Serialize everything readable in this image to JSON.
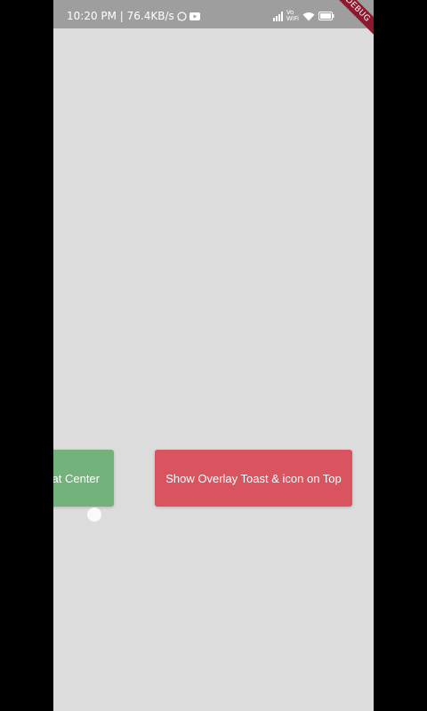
{
  "status_bar": {
    "time_speed": "10:20 PM | 76.4KB/s",
    "vowifi_top": "Vo",
    "vowifi_bottom": "WiFi",
    "icons": [
      "whatsapp-icon",
      "youtube-icon",
      "signal-icon",
      "vowifi-icon",
      "wifi-icon",
      "battery-icon"
    ]
  },
  "debug_banner": {
    "label": "DEBUG"
  },
  "buttons": {
    "center_label": "Show Overlay Toast at Center",
    "center_visible_label": "at Center",
    "top_label": "Show Overlay Toast & icon on Top"
  },
  "colors": {
    "background": "#dcdcdc",
    "status_bar": "#9e9e9e",
    "green_button": "#74b27c",
    "red_button": "#d9545e",
    "debug_banner": "#8b1a2d"
  }
}
